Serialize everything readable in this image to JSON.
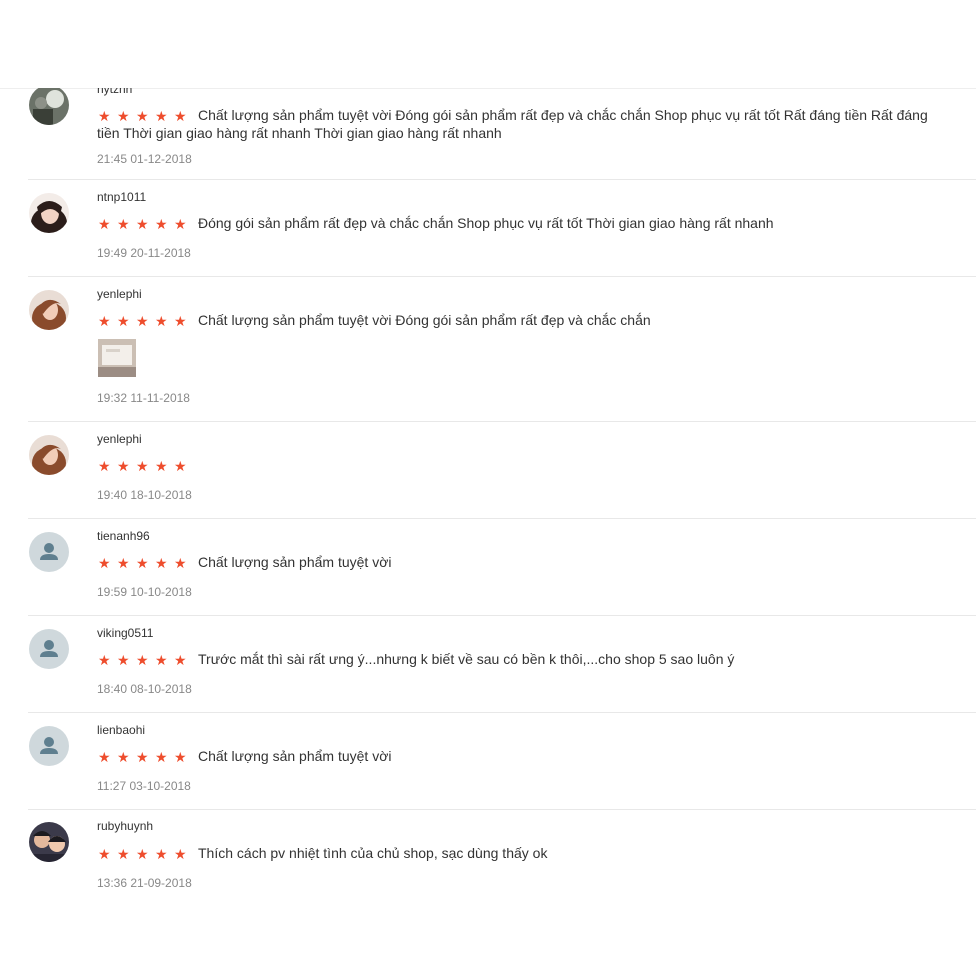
{
  "accent_color": "#ee4d2d",
  "reviews": [
    {
      "username": "nytznn",
      "stars": [
        "★",
        "★",
        "★",
        "★",
        "★"
      ],
      "comment": "Chất lượng sản phẩm tuyệt vời Đóng gói sản phẩm rất đẹp và chắc chắn Shop phục vụ rất tốt Rất đáng tiền Rất đáng tiền Thời gian giao hàng rất nhanh Thời gian giao hàng rất nhanh",
      "time": "21:45 01-12-2018"
    },
    {
      "username": "ntnp1011",
      "stars": [
        "★",
        "★",
        "★",
        "★",
        "★"
      ],
      "comment": "Đóng gói sản phẩm rất đẹp và chắc chắn Shop phục vụ rất tốt Thời gian giao hàng rất nhanh",
      "time": "19:49 20-11-2018"
    },
    {
      "username": "yenlephi",
      "stars": [
        "★",
        "★",
        "★",
        "★",
        "★"
      ],
      "comment": "Chất lượng sản phẩm tuyệt vời Đóng gói sản phẩm rất đẹp và chắc chắn",
      "time": "19:32 11-11-2018"
    },
    {
      "username": "yenlephi",
      "stars": [
        "★",
        "★",
        "★",
        "★",
        "★"
      ],
      "comment": "",
      "time": "19:40 18-10-2018"
    },
    {
      "username": "tienanh96",
      "stars": [
        "★",
        "★",
        "★",
        "★",
        "★"
      ],
      "comment": "Chất lượng sản phẩm tuyệt vời",
      "time": "19:59 10-10-2018"
    },
    {
      "username": "viking0511",
      "stars": [
        "★",
        "★",
        "★",
        "★",
        "★"
      ],
      "comment": "Trước mắt thì sài rất ưng ý...nhưng k biết về sau có bền k thôi,...cho shop 5 sao luôn ý",
      "time": "18:40 08-10-2018"
    },
    {
      "username": "lienbaohi",
      "stars": [
        "★",
        "★",
        "★",
        "★",
        "★"
      ],
      "comment": "Chất lượng sản phẩm tuyệt vời",
      "time": "11:27 03-10-2018"
    },
    {
      "username": "rubyhuynh",
      "stars": [
        "★",
        "★",
        "★",
        "★",
        "★"
      ],
      "comment": "Thích cách pv nhiệt tình của chủ shop, sạc dùng thấy ok",
      "time": "13:36 21-09-2018"
    }
  ]
}
